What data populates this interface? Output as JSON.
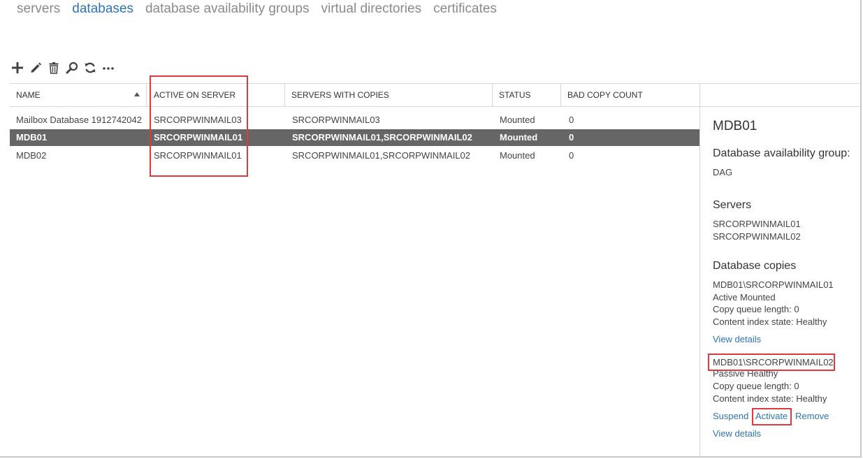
{
  "nav": {
    "tabs": [
      {
        "label": "servers"
      },
      {
        "label": "databases",
        "active": true
      },
      {
        "label": "database availability groups"
      },
      {
        "label": "virtual directories"
      },
      {
        "label": "certificates"
      }
    ]
  },
  "toolbar": {
    "buttons": [
      {
        "icon": "plus-icon"
      },
      {
        "icon": "pencil-icon"
      },
      {
        "icon": "trash-icon"
      },
      {
        "icon": "search-icon"
      },
      {
        "icon": "refresh-icon"
      },
      {
        "icon": "more-icon"
      }
    ]
  },
  "table": {
    "columns": [
      "NAME",
      "ACTIVE ON SERVER",
      "SERVERS WITH COPIES",
      "STATUS",
      "BAD COPY COUNT"
    ],
    "rows": [
      [
        "Mailbox Database 1912742042",
        "SRCORPWINMAIL03",
        "SRCORPWINMAIL03",
        "Mounted",
        "0"
      ],
      [
        "MDB01",
        "SRCORPWINMAIL01",
        "SRCORPWINMAIL01,SRCORPWINMAIL02",
        "Mounted",
        "0"
      ],
      [
        "MDB02",
        "SRCORPWINMAIL01",
        "SRCORPWINMAIL01,SRCORPWINMAIL02",
        "Mounted",
        "0"
      ]
    ],
    "selected_row": 1
  },
  "details": {
    "title": "MDB01",
    "dag_heading": "Database availability group:",
    "dag_value": "DAG",
    "servers_heading": "Servers",
    "servers": [
      "SRCORPWINMAIL01",
      "SRCORPWINMAIL02"
    ],
    "copies_heading": "Database copies",
    "copies": [
      {
        "name": "MDB01\\SRCORPWINMAIL01",
        "state": " Active Mounted",
        "queue": "Copy queue length: 0",
        "index": "Content index state:  Healthy",
        "view_details": "View details"
      },
      {
        "name": "MDB01\\SRCORPWINMAIL02",
        "state": " Passive Healthy",
        "queue": "Copy queue length: 0",
        "index": "Content index state:  Healthy",
        "suspend": "Suspend",
        "activate": "Activate",
        "remove": "Remove",
        "view_details": "View details"
      }
    ]
  },
  "colors": {
    "accent": "#2f74b5",
    "selected_row": "#666666",
    "highlight": "#e03a3e"
  }
}
